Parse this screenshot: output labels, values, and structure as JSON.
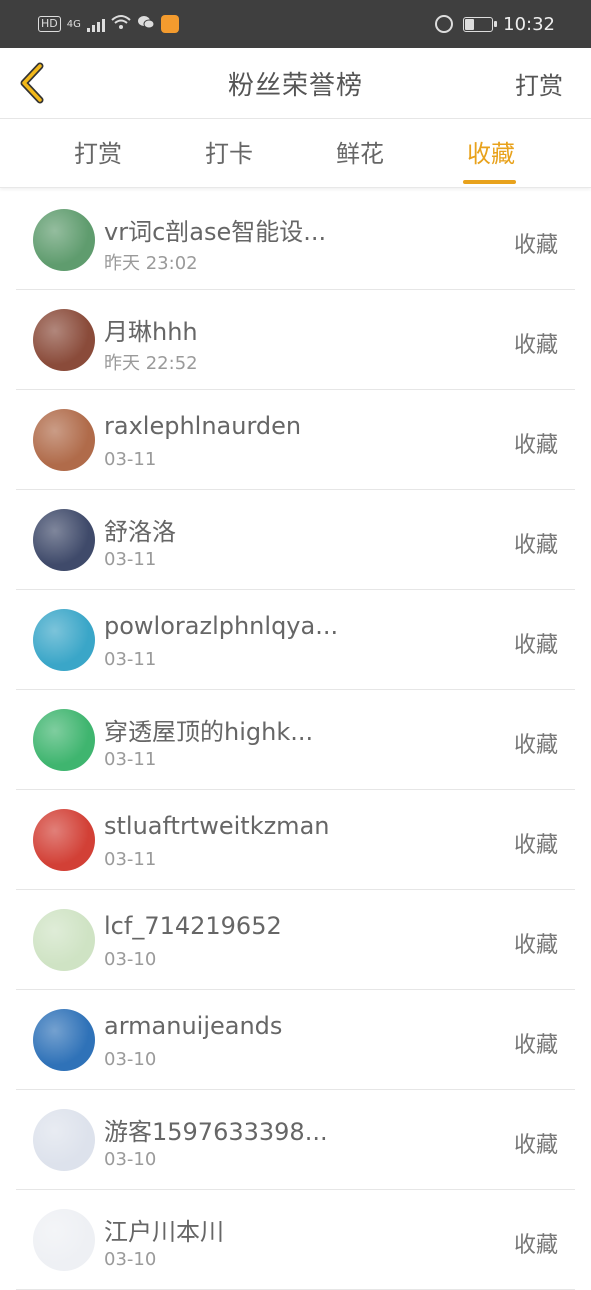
{
  "status_bar": {
    "network_badge": "HD",
    "network_type": "4G",
    "time": "10:32",
    "battery_level": 0.3
  },
  "nav": {
    "title": "粉丝荣誉榜",
    "right_action": "打赏",
    "back_icon": "chevron-left-icon"
  },
  "tabs": [
    {
      "label": "打赏",
      "active": false
    },
    {
      "label": "打卡",
      "active": false
    },
    {
      "label": "鲜花",
      "active": false
    },
    {
      "label": "收藏",
      "active": true
    }
  ],
  "accent_color": "#e8a21c",
  "rows": [
    {
      "name": "vr词c剖ase智能设...",
      "time": "昨天 23:02",
      "action": "收藏",
      "avatar_color": "#5f9c6e"
    },
    {
      "name": "月琳hhh",
      "time": "昨天 22:52",
      "action": "收藏",
      "avatar_color": "#8a4b3a"
    },
    {
      "name": "raxlephlnaurden",
      "time": "03-11",
      "action": "收藏",
      "avatar_color": "#b06b4a"
    },
    {
      "name": "舒洛洛",
      "time": "03-11",
      "action": "收藏",
      "avatar_color": "#3f4a6a"
    },
    {
      "name": "powlorazlphnlqya...",
      "time": "03-11",
      "action": "收藏",
      "avatar_color": "#3aa6c8"
    },
    {
      "name": "穿透屋顶的highk...",
      "time": "03-11",
      "action": "收藏",
      "avatar_color": "#3fb56f"
    },
    {
      "name": "stluaftrtweitkzman",
      "time": "03-11",
      "action": "收藏",
      "avatar_color": "#d24036"
    },
    {
      "name": "lcf_714219652",
      "time": "03-10",
      "action": "收藏",
      "avatar_color": "#cfe3c4"
    },
    {
      "name": "armanuijeands",
      "time": "03-10",
      "action": "收藏",
      "avatar_color": "#2f72b8"
    },
    {
      "name": "游客1597633398...",
      "time": "03-10",
      "action": "收藏",
      "avatar_color": "#dde2ec"
    },
    {
      "name": "江户川本川",
      "time": "03-10",
      "action": "收藏",
      "avatar_color": "#eef0f4"
    }
  ]
}
